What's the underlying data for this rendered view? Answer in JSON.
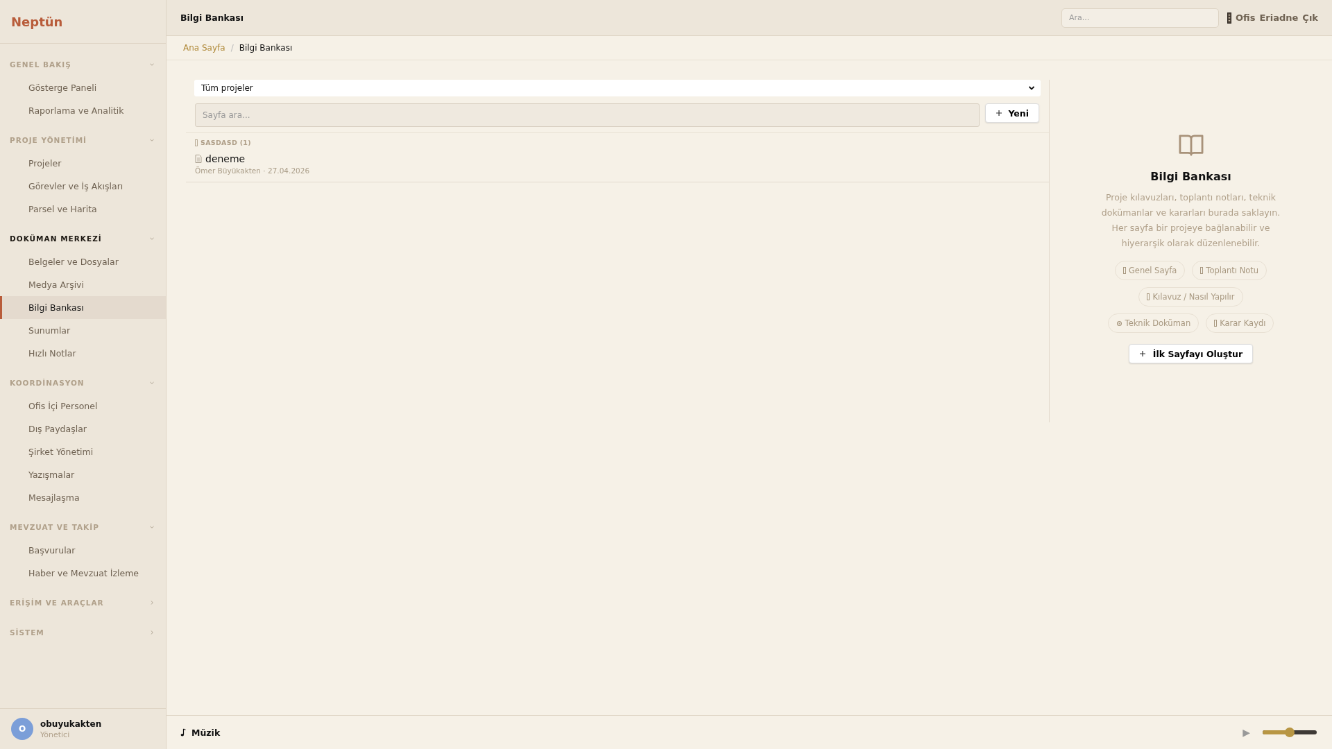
{
  "app": {
    "logo": "Neptün"
  },
  "sidebar": {
    "sections": [
      {
        "title": "GENEL BAKIŞ",
        "expanded": true,
        "active": false,
        "items": [
          {
            "label": "Gösterge Paneli",
            "selected": false
          },
          {
            "label": "Raporlama ve Analitik",
            "selected": false
          }
        ]
      },
      {
        "title": "PROJE YÖNETİMİ",
        "expanded": true,
        "active": false,
        "items": [
          {
            "label": "Projeler",
            "selected": false
          },
          {
            "label": "Görevler ve İş Akışları",
            "selected": false
          },
          {
            "label": "Parsel ve Harita",
            "selected": false
          }
        ]
      },
      {
        "title": "DOKÜMAN MERKEZİ",
        "expanded": true,
        "active": true,
        "items": [
          {
            "label": "Belgeler ve Dosyalar",
            "selected": false
          },
          {
            "label": "Medya Arşivi",
            "selected": false
          },
          {
            "label": "Bilgi Bankası",
            "selected": true
          },
          {
            "label": "Sunumlar",
            "selected": false
          },
          {
            "label": "Hızlı Notlar",
            "selected": false
          }
        ]
      },
      {
        "title": "KOORDİNASYON",
        "expanded": true,
        "active": false,
        "items": [
          {
            "label": "Ofis İçi Personel",
            "selected": false
          },
          {
            "label": "Dış Paydaşlar",
            "selected": false
          },
          {
            "label": "Şirket Yönetimi",
            "selected": false
          },
          {
            "label": "Yazışmalar",
            "selected": false
          },
          {
            "label": "Mesajlaşma",
            "selected": false
          }
        ]
      },
      {
        "title": "MEVZUAT VE TAKİP",
        "expanded": true,
        "active": false,
        "items": [
          {
            "label": "Başvurular",
            "selected": false
          },
          {
            "label": "Haber ve Mevzuat İzleme",
            "selected": false
          }
        ]
      },
      {
        "title": "ERİŞİM VE ARAÇLAR",
        "expanded": false,
        "active": false
      },
      {
        "title": "SİSTEM",
        "expanded": false,
        "active": false
      }
    ],
    "user": {
      "initial": "O",
      "name": "obuyukakten",
      "role": "Yönetici"
    }
  },
  "topbar": {
    "title": "Bilgi Bankası",
    "search": {
      "placeholder": "Ara..."
    },
    "office": "Ofis",
    "user": "Eriadne",
    "logout": "Çık"
  },
  "breadcrumb": {
    "separator": "/",
    "items": [
      {
        "label": "Ana Sayfa",
        "link": true
      },
      {
        "label": "Bilgi Bankası",
        "link": false
      }
    ]
  },
  "list": {
    "project_select": "Tüm projeler",
    "search": {
      "placeholder": "Sayfa ara..."
    },
    "new_button": "Yeni",
    "groups": [
      {
        "title": "SASDASD (1)",
        "pages": [
          {
            "title": "deneme",
            "meta": "Ömer Büyükakten · 27.04.2026"
          }
        ]
      }
    ]
  },
  "empty_panel": {
    "title": "Bilgi Bankası",
    "description": "Proje kılavuzları, toplantı notları, teknik dokümanlar ve kararları burada saklayın. Her sayfa bir projeye bağlanabilir ve hiyerarşik olarak düzenlenebilir.",
    "tags": [
      [
        {
          "label": "Genel Sayfa",
          "kind": "page"
        },
        {
          "label": "Toplantı Notu",
          "kind": "page"
        }
      ],
      [
        {
          "label": "Kılavuz / Nasıl Yapılır",
          "kind": "page"
        }
      ],
      [
        {
          "label": "Teknik Doküman",
          "kind": "gear"
        },
        {
          "label": "Karar Kaydı",
          "kind": "page"
        }
      ]
    ],
    "create_button": "İlk Sayfayı Oluştur"
  },
  "player": {
    "label": "Müzik",
    "play_icon": "▶",
    "volume": {
      "level": 0.5
    }
  }
}
